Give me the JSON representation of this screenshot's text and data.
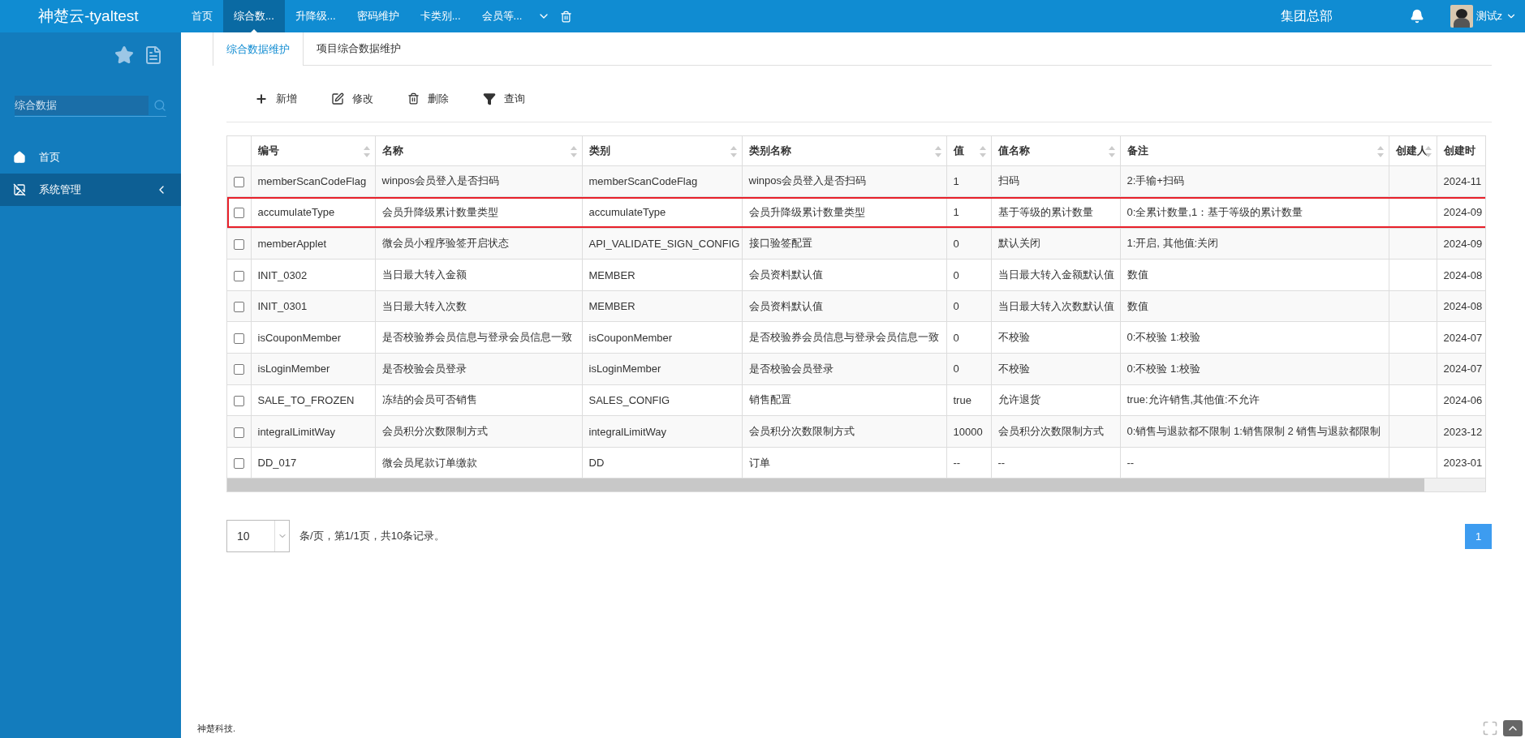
{
  "header": {
    "brand": "神楚云-tyaltest",
    "nav": [
      {
        "label": "首页",
        "selected": false
      },
      {
        "label": "综合数...",
        "selected": true
      },
      {
        "label": "升降级...",
        "selected": false
      },
      {
        "label": "密码维护",
        "selected": false
      },
      {
        "label": "卡类别...",
        "selected": false
      },
      {
        "label": "会员等...",
        "selected": false
      }
    ],
    "org": "集团总部",
    "user": "测试z"
  },
  "sidebar": {
    "search": {
      "value": "综合数据"
    },
    "items": [
      {
        "label": "首页",
        "kind": "home",
        "selected": false
      },
      {
        "label": "系统管理",
        "kind": "group",
        "selected": true
      }
    ]
  },
  "tabs": [
    {
      "label": "综合数据维护",
      "selected": true
    },
    {
      "label": "项目综合数据维护",
      "selected": false
    }
  ],
  "toolbar": [
    {
      "label": "新增",
      "kind": "add"
    },
    {
      "label": "修改",
      "kind": "edit"
    },
    {
      "label": "删除",
      "kind": "delete"
    },
    {
      "label": "查询",
      "kind": "query"
    }
  ],
  "table": {
    "columns": [
      {
        "label": "编号",
        "sortable": true
      },
      {
        "label": "名称",
        "sortable": true
      },
      {
        "label": "类别",
        "sortable": true
      },
      {
        "label": "类别名称",
        "sortable": true
      },
      {
        "label": "值",
        "sortable": true
      },
      {
        "label": "值名称",
        "sortable": true
      },
      {
        "label": "备注",
        "sortable": true
      },
      {
        "label": "创建人",
        "sortable": true
      },
      {
        "label": "创建时",
        "sortable": false
      }
    ],
    "rows": [
      {
        "checked": false,
        "highlighted": false,
        "cells": [
          "memberScanCodeFlag",
          "winpos会员登入是否扫码",
          "memberScanCodeFlag",
          "winpos会员登入是否扫码",
          "1",
          "扫码",
          "2:手输+扫码",
          "",
          "2024-11"
        ]
      },
      {
        "checked": false,
        "highlighted": true,
        "cells": [
          "accumulateType",
          "会员升降级累计数量类型",
          "accumulateType",
          "会员升降级累计数量类型",
          "1",
          "基于等级的累计数量",
          "0:全累计数量,1：基于等级的累计数量",
          "",
          "2024-09"
        ]
      },
      {
        "checked": false,
        "highlighted": false,
        "cells": [
          "memberApplet",
          "微会员小程序验签开启状态",
          "API_VALIDATE_SIGN_CONFIG",
          "接口验签配置",
          "0",
          "默认关闭",
          "1:开启, 其他值:关闭",
          "",
          "2024-09"
        ]
      },
      {
        "checked": false,
        "highlighted": false,
        "cells": [
          "INIT_0302",
          "当日最大转入金额",
          "MEMBER",
          "会员资料默认值",
          "0",
          "当日最大转入金额默认值",
          "数值",
          "",
          "2024-08"
        ]
      },
      {
        "checked": false,
        "highlighted": false,
        "cells": [
          "INIT_0301",
          "当日最大转入次数",
          "MEMBER",
          "会员资料默认值",
          "0",
          "当日最大转入次数默认值",
          "数值",
          "",
          "2024-08"
        ]
      },
      {
        "checked": false,
        "highlighted": false,
        "cells": [
          "isCouponMember",
          "是否校验券会员信息与登录会员信息一致",
          "isCouponMember",
          "是否校验券会员信息与登录会员信息一致",
          "0",
          "不校验",
          "0:不校验 1:校验",
          "",
          "2024-07"
        ]
      },
      {
        "checked": false,
        "highlighted": false,
        "cells": [
          "isLoginMember",
          "是否校验会员登录",
          "isLoginMember",
          "是否校验会员登录",
          "0",
          "不校验",
          "0:不校验 1:校验",
          "",
          "2024-07"
        ]
      },
      {
        "checked": false,
        "highlighted": false,
        "cells": [
          "SALE_TO_FROZEN",
          "冻结的会员可否销售",
          "SALES_CONFIG",
          "销售配置",
          "true",
          "允许退货",
          "true:允许销售,其他值:不允许",
          "",
          "2024-06"
        ]
      },
      {
        "checked": false,
        "highlighted": false,
        "cells": [
          "integralLimitWay",
          "会员积分次数限制方式",
          "integralLimitWay",
          "会员积分次数限制方式",
          "10000",
          "会员积分次数限制方式",
          "0:销售与退款都不限制 1:销售限制 2 销售与退款都限制",
          "",
          "2023-12"
        ]
      },
      {
        "checked": false,
        "highlighted": false,
        "cells": [
          "DD_017",
          "微会员尾款订单缴款",
          "DD",
          "订单",
          "--",
          "--",
          "--",
          "",
          "2023-01"
        ]
      }
    ]
  },
  "pagination": {
    "page_size": "10",
    "summary": "条/页，第1/1页，共10条记录。",
    "pages": [
      {
        "label": "1",
        "selected": true
      }
    ]
  },
  "footer": {
    "text": "神楚科技."
  }
}
